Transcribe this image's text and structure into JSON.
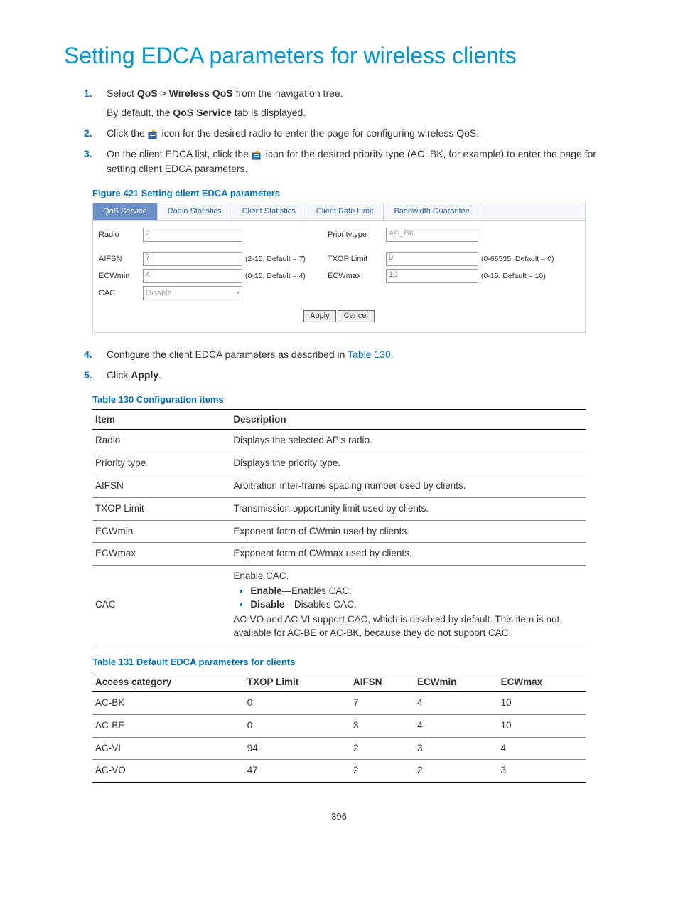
{
  "title": "Setting EDCA parameters for wireless clients",
  "steps": {
    "s1a": "Select ",
    "s1b": "QoS",
    "s1c": " > ",
    "s1d": "Wireless QoS",
    "s1e": " from the navigation tree.",
    "s1sub_a": "By default, the ",
    "s1sub_b": "QoS Service",
    "s1sub_c": " tab is displayed.",
    "s2a": "Click the ",
    "s2b": " icon for the desired radio to enter the page for configuring wireless QoS.",
    "s3a": "On the client EDCA list, click the ",
    "s3b": " icon for the desired priority type (AC_BK, for example) to enter the page for setting client EDCA parameters.",
    "s4a": "Configure the client EDCA parameters as described in ",
    "s4b": "Table 130",
    "s4c": ".",
    "s5a": "Click ",
    "s5b": "Apply",
    "s5c": "."
  },
  "fig_caption": "Figure 421 Setting client EDCA parameters",
  "tabs": [
    "QoS Service",
    "Radio Statistics",
    "Client Statistics",
    "Client Rate Limit",
    "Bandwidth Guarantee"
  ],
  "form": {
    "radio_label": "Radio",
    "radio_value": "2",
    "prioritytype_label": "Prioritytype",
    "prioritytype_value": "AC_BK",
    "aifsn_label": "AIFSN",
    "aifsn_value": "7",
    "aifsn_hint": "(2-15, Default = 7)",
    "txop_label": "TXOP Limit",
    "txop_value": "0",
    "txop_hint": "(0-65535, Default = 0)",
    "ecwmin_label": "ECWmin",
    "ecwmin_value": "4",
    "ecwmin_hint": "(0-15, Default = 4)",
    "ecwmax_label": "ECWmax",
    "ecwmax_value": "10",
    "ecwmax_hint": "(0-15, Default = 10)",
    "cac_label": "CAC",
    "cac_value": "Disable",
    "apply": "Apply",
    "cancel": "Cancel"
  },
  "table130_caption": "Table 130 Configuration items",
  "table130": {
    "h1": "Item",
    "h2": "Description",
    "rows": [
      {
        "item": "Radio",
        "desc": "Displays the selected AP's radio."
      },
      {
        "item": "Priority type",
        "desc": "Displays the priority type."
      },
      {
        "item": "AIFSN",
        "desc": "Arbitration inter-frame spacing number used by clients."
      },
      {
        "item": "TXOP Limit",
        "desc": "Transmission opportunity limit used by clients."
      },
      {
        "item": "ECWmin",
        "desc": "Exponent form of CWmin used by clients."
      },
      {
        "item": "ECWmax",
        "desc": "Exponent form of CWmax used by clients."
      }
    ],
    "cac_item": "CAC",
    "cac_intro": "Enable CAC.",
    "cac_enable_b": "Enable",
    "cac_enable_t": "—Enables CAC.",
    "cac_disable_b": "Disable",
    "cac_disable_t": "—Disables CAC.",
    "cac_note": "AC-VO and AC-VI support CAC, which is disabled by default. This item is not available for AC-BE or AC-BK, because they do not support CAC."
  },
  "table131_caption": "Table 131 Default EDCA parameters for clients",
  "table131": {
    "headers": [
      "Access category",
      "TXOP Limit",
      "AIFSN",
      "ECWmin",
      "ECWmax"
    ],
    "rows": [
      [
        "AC-BK",
        "0",
        "7",
        "4",
        "10"
      ],
      [
        "AC-BE",
        "0",
        "3",
        "4",
        "10"
      ],
      [
        "AC-VI",
        "94",
        "2",
        "3",
        "4"
      ],
      [
        "AC-VO",
        "47",
        "2",
        "2",
        "3"
      ]
    ]
  },
  "page_number": "396"
}
